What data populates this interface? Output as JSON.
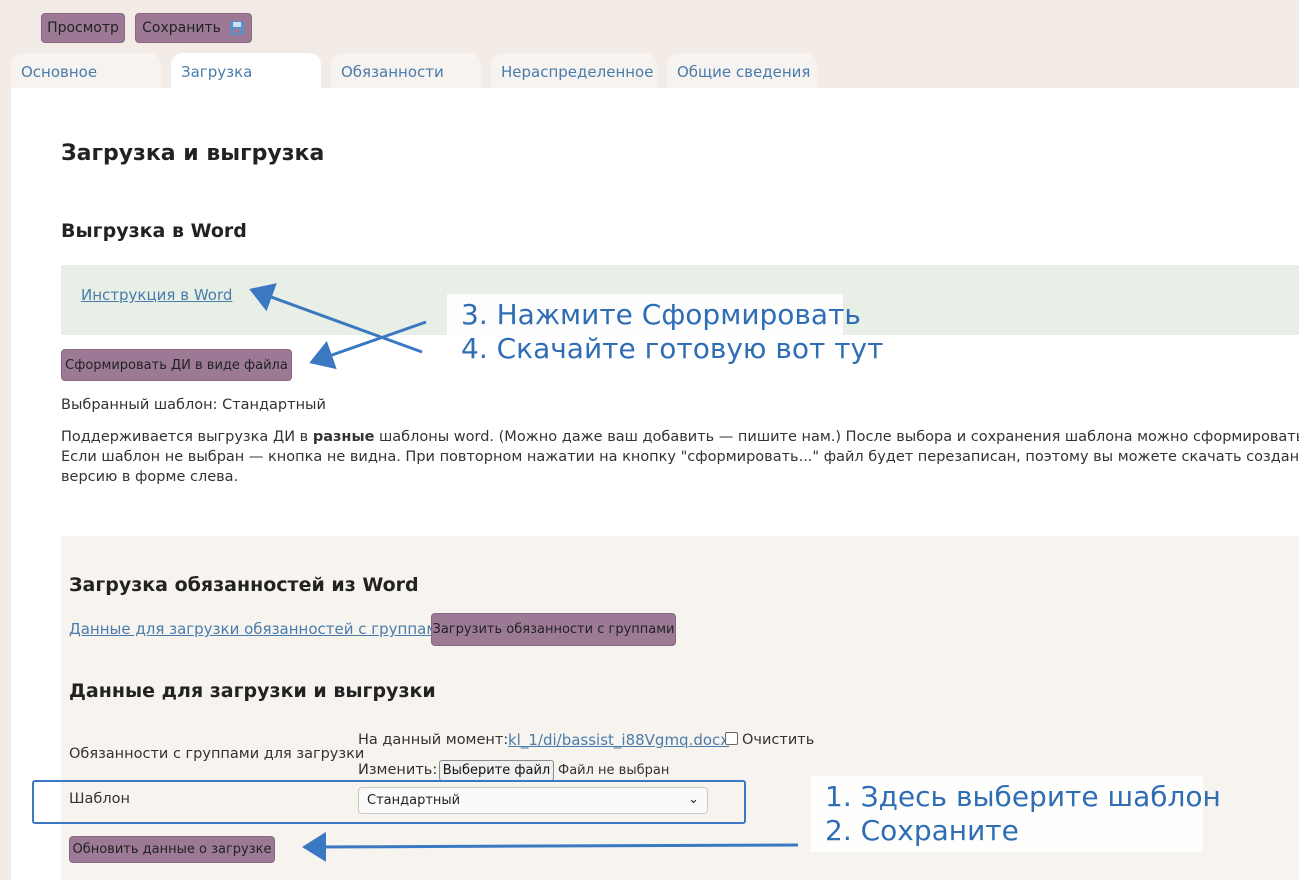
{
  "toolbar": {
    "preview_label": "Просмотр",
    "save_label": "Сохранить",
    "save_icon": "floppy-disk-icon"
  },
  "tabs": [
    {
      "label": "Основное",
      "active": false
    },
    {
      "label": "Загрузка",
      "active": true
    },
    {
      "label": "Обязанности",
      "active": false
    },
    {
      "label": "Нераспределенное",
      "active": false
    },
    {
      "label": "Общие сведения",
      "active": false
    }
  ],
  "page": {
    "title": "Загрузка и выгрузка",
    "export_section": {
      "heading": "Выгрузка в Word",
      "instruction_link": "Инструкция в Word",
      "generate_button": "Сформировать ДИ в виде файла",
      "selected_template": "Выбранный шаблон: Стандартный",
      "description_part1": "Поддерживается выгрузка ДИ в ",
      "description_bold": "разные",
      "description_part2": " шаблоны word. (Можно даже ваш добавить — пишите нам.) После выбора и сохранения шаблона можно сформировать word",
      "description_line2": "Если шаблон не выбран — кнопка не видна. При повторном нажатии на кнопку \"сформировать...\" файл будет перезаписан, поэтому вы можете скачать созданный",
      "description_line3": "версию в форме слева."
    },
    "import_section": {
      "heading": "Загрузка обязанностей из Word",
      "data_link": "Данные для загрузки обязанностей с группами",
      "upload_button": "Загрузить обязанности с группами"
    },
    "data_section": {
      "heading": "Данные для загрузки и выгрузки",
      "field_label": "Обязанности с группами для загрузки",
      "current_label": "На данный момент:",
      "current_file": "kl_1/di/bassist_i88Vgmq.docx",
      "clear_label": "Очистить",
      "change_label": "Изменить:",
      "choose_file_button": "Выберите файл",
      "no_file_text": "Файл не выбран",
      "template_label": "Шаблон",
      "template_value": "Стандартный",
      "update_button": "Обновить данные о загрузке"
    }
  },
  "annotations": {
    "top_line1": "3. Нажмите Сформировать",
    "top_line2": "4. Скачайте готовую вот тут",
    "bottom_line1": "1. Здесь выберите шаблон",
    "bottom_line2": "2. Сохраните",
    "color": "#2f6db5"
  },
  "colors": {
    "background": "#f2ebe6",
    "button": "#9c7a96",
    "link": "#4a7cab",
    "green_panel": "#e7efe6",
    "beige_panel": "#f7f3ef"
  }
}
